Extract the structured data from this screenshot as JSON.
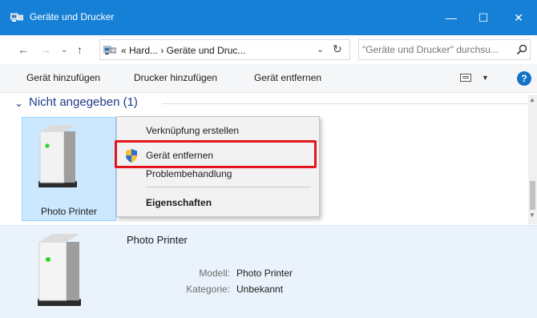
{
  "window": {
    "title": "Geräte und Drucker",
    "icon": "devices-printers-icon",
    "controls": {
      "minimize": "—",
      "maximize": "☐",
      "close": "✕"
    }
  },
  "address_bar": {
    "back": "←",
    "forward": "→",
    "recent": "⌄",
    "up": "↑",
    "path": "« Hard...  ›  Geräte und Druc...",
    "dropdown": "⌄",
    "refresh": "↻"
  },
  "search": {
    "placeholder": "\"Geräte und Drucker\" durchsu..."
  },
  "toolbar": {
    "add_device": "Gerät hinzufügen",
    "add_printer": "Drucker hinzufügen",
    "remove_device": "Gerät entfernen",
    "view_dropdown": "▼",
    "help": "?"
  },
  "group": {
    "chevron": "⌄",
    "label": "Nicht angegeben (1)"
  },
  "device": {
    "name": "Photo Printer"
  },
  "context_menu": {
    "items": [
      {
        "label": "Verknüpfung erstellen"
      },
      {
        "label": "Gerät entfernen",
        "icon": "uac-shield-icon",
        "highlighted": true
      },
      {
        "label": "Problembehandlung"
      },
      {
        "label": "Eigenschaften",
        "bold": true
      }
    ]
  },
  "details": {
    "name": "Photo Printer",
    "model_label": "Modell:",
    "model_value": "Photo Printer",
    "category_label": "Kategorie:",
    "category_value": "Unbekannt"
  },
  "colors": {
    "titlebar": "#1680d6",
    "selection": "#cce8ff",
    "highlight_border": "#e3141b",
    "group_header": "#1e3a8a"
  }
}
